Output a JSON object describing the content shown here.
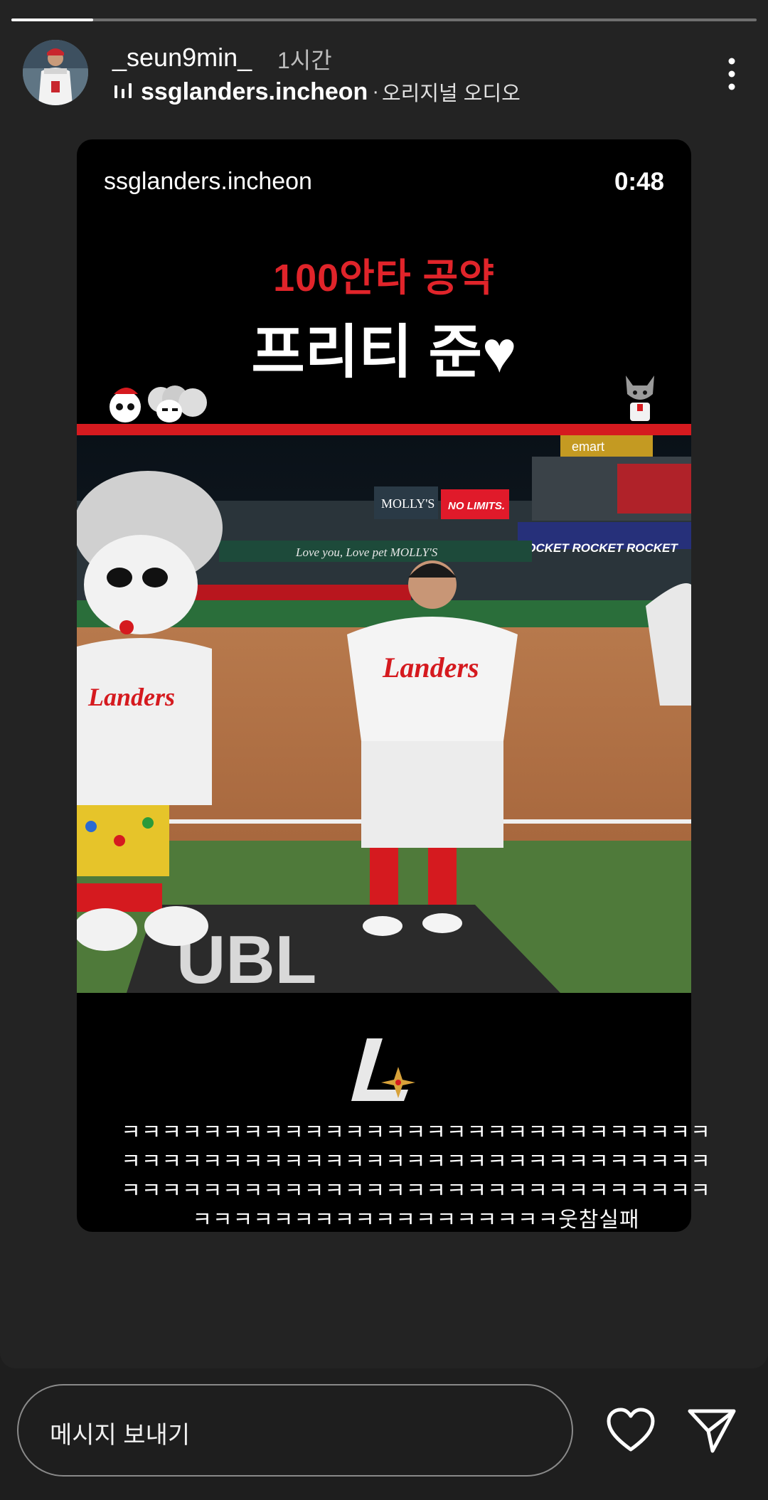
{
  "story": {
    "progress": 0.11,
    "username": "_seun9min_",
    "time": "1시간",
    "audio_account": "ssglanders.incheon",
    "audio_separator": "·",
    "audio_track": "오리지널 오디오"
  },
  "reel": {
    "account": "ssglanders.incheon",
    "duration": "0:48",
    "headline": "100안타 공약",
    "title": "프리티 준♥",
    "stadium_signs": [
      "MOLLY'S",
      "NO LIMITS.",
      "Love you, Love pet  MOLLY'S",
      "ROCKET  ROCKET  ROCKET",
      "emart"
    ],
    "jersey_text": "Landers",
    "plate_text": "UBL",
    "accent_color": "#d51a1f"
  },
  "comment": "ㅋㅋㅋㅋㅋㅋㅋㅋㅋㅋㅋㅋㅋㅋㅋㅋㅋㅋㅋㅋㅋㅋㅋㅋㅋㅋㅋㅋㅋㅋㅋㅋㅋㅋㅋㅋㅋㅋㅋㅋㅋㅋㅋㅋㅋㅋㅋㅋㅋㅋㅋㅋㅋㅋㅋㅋㅋㅋㅋㅋㅋㅋㅋㅋㅋㅋㅋㅋㅋㅋㅋㅋㅋㅋㅋㅋㅋㅋㅋㅋㅋㅋㅋㅋㅋㅋㅋㅋㅋㅋㅋㅋㅋㅋㅋㅋㅋㅋㅋㅋㅋㅋㅋㅋㅋ웃참실패",
  "footer": {
    "message_placeholder": "메시지 보내기",
    "like_icon": "heart-icon",
    "send_icon": "paper-plane-icon"
  }
}
